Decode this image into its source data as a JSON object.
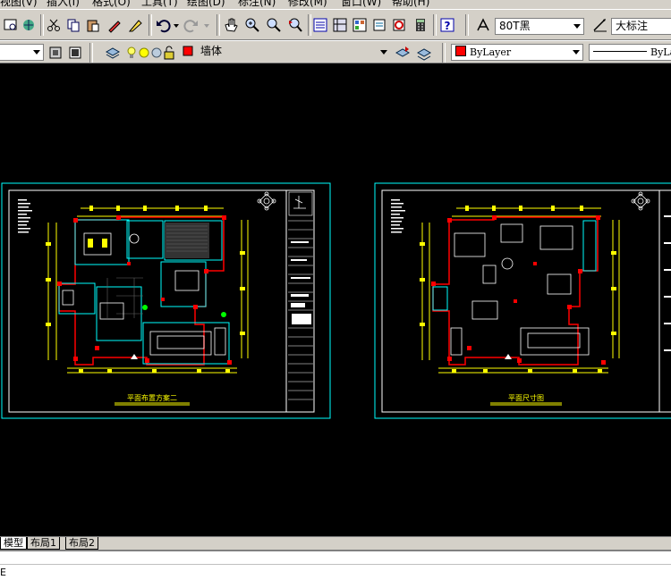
{
  "menu": {
    "items": [
      {
        "label": "视图(V)"
      },
      {
        "label": "插入(I)"
      },
      {
        "label": "格式(O)"
      },
      {
        "label": "工具(T)"
      },
      {
        "label": "绘图(D)"
      },
      {
        "label": "标注(N)"
      },
      {
        "label": "修改(M)"
      },
      {
        "label": "窗口(W)"
      },
      {
        "label": "帮助(H)"
      }
    ]
  },
  "toolbar": {
    "text_style": "80T黑",
    "dim_style": "大标注"
  },
  "layers": {
    "current_layer": "墙体",
    "color": "ByLayer",
    "linetype": "ByLa"
  },
  "drawings": {
    "left_title": "平面布置方案二",
    "right_title": "平面尺寸图"
  },
  "tabs": [
    {
      "label": "模型"
    },
    {
      "label": "布局1"
    },
    {
      "label": "布局2"
    }
  ],
  "command": {
    "text": "E"
  },
  "colors": {
    "canvas": "#000000",
    "frame": "#00ffff",
    "wall": "#ff0000",
    "dimension": "#ffff00",
    "furniture": "#ffffff",
    "chrome": "#d4d0c8"
  }
}
